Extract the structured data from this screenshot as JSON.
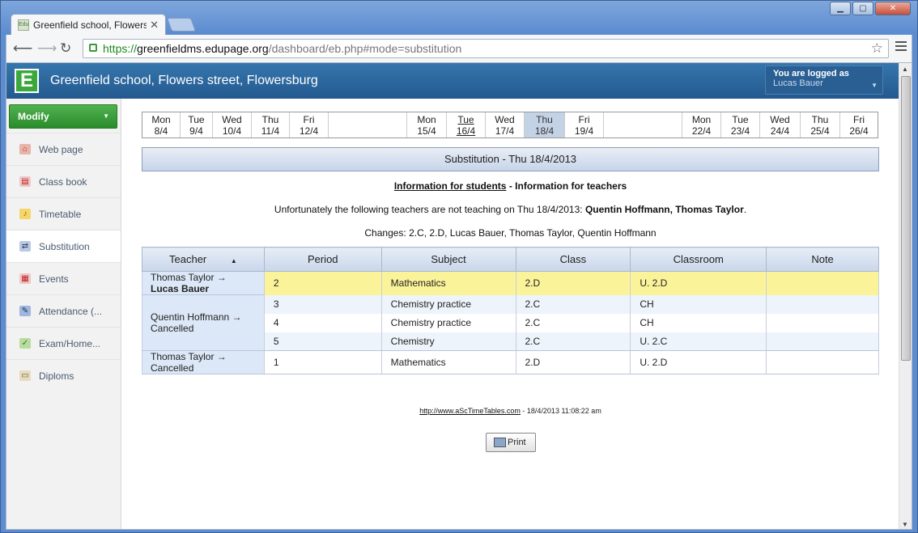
{
  "browser": {
    "tab_title": "Greenfield school, Flowers st",
    "tab_favicon": "Edu",
    "url_scheme": "https://",
    "url_host": "greenfieldms.edupage.org",
    "url_path": "/dashboard/eb.php#mode=substitution"
  },
  "header": {
    "logo": "E",
    "school_name": "Greenfield school, Flowers street, Flowersburg",
    "login_label": "You are logged as",
    "user_name": "Lucas Bauer"
  },
  "sidebar": {
    "modify_label": "Modify",
    "items": [
      {
        "label": "Web page",
        "icon": "house-icon"
      },
      {
        "label": "Class book",
        "icon": "book-icon"
      },
      {
        "label": "Timetable",
        "icon": "bell-icon"
      },
      {
        "label": "Substitution",
        "icon": "substitution-icon"
      },
      {
        "label": "Events",
        "icon": "calendar-icon"
      },
      {
        "label": "Attendance (...",
        "icon": "attendance-icon"
      },
      {
        "label": "Exam/Home...",
        "icon": "exam-icon"
      },
      {
        "label": "Diploms",
        "icon": "diploma-icon"
      }
    ]
  },
  "weeks": [
    [
      {
        "d": "Mon",
        "n": "8/4"
      },
      {
        "d": "Tue",
        "n": "9/4"
      },
      {
        "d": "Wed",
        "n": "10/4"
      },
      {
        "d": "Thu",
        "n": "11/4"
      },
      {
        "d": "Fri",
        "n": "12/4"
      }
    ],
    [
      {
        "d": "Mon",
        "n": "15/4"
      },
      {
        "d": "Tue",
        "n": "16/4"
      },
      {
        "d": "Wed",
        "n": "17/4"
      },
      {
        "d": "Thu",
        "n": "18/4"
      },
      {
        "d": "Fri",
        "n": "19/4"
      }
    ],
    [
      {
        "d": "Mon",
        "n": "22/4"
      },
      {
        "d": "Tue",
        "n": "23/4"
      },
      {
        "d": "Wed",
        "n": "24/4"
      },
      {
        "d": "Thu",
        "n": "25/4"
      },
      {
        "d": "Fri",
        "n": "26/4"
      }
    ]
  ],
  "main": {
    "heading": "Substitution - Thu 18/4/2013",
    "link_students": "Information for students",
    "link_separator": " - ",
    "link_teachers": "Information for teachers",
    "absent_prefix": "Unfortunately the following teachers are not teaching on Thu 18/4/2013: ",
    "absent_names": "Quentin Hoffmann, Thomas Taylor",
    "absent_suffix": ".",
    "changes": "Changes: 2.C, 2.D, Lucas Bauer, Thomas Taylor, Quentin Hoffmann"
  },
  "table": {
    "headers": [
      "Teacher",
      "Period",
      "Subject",
      "Class",
      "Classroom",
      "Note"
    ],
    "groups": [
      {
        "teacher": "Thomas Taylor →",
        "sub": "Lucas Bauer",
        "sub_bold": true,
        "rows": [
          {
            "period": "2",
            "subject": "Mathematics",
            "class": "2.D",
            "room": "U. 2.D",
            "note": ""
          }
        ]
      },
      {
        "teacher": "Quentin Hoffmann →",
        "sub": "Cancelled",
        "sub_bold": false,
        "rows": [
          {
            "period": "3",
            "subject": "Chemistry practice",
            "class": "2.C",
            "room": "CH",
            "note": ""
          },
          {
            "period": "4",
            "subject": "Chemistry practice",
            "class": "2.C",
            "room": "CH",
            "note": ""
          },
          {
            "period": "5",
            "subject": "Chemistry",
            "class": "2.C",
            "room": "U. 2.C",
            "note": ""
          }
        ]
      },
      {
        "teacher": "Thomas Taylor →",
        "sub": "Cancelled",
        "sub_bold": false,
        "rows": [
          {
            "period": "1",
            "subject": "Mathematics",
            "class": "2.D",
            "room": "U. 2.D",
            "note": ""
          }
        ]
      }
    ]
  },
  "footer": {
    "link": "http://www.aScTimeTables.com",
    "text": " - 18/4/2013 11:08:22 am"
  },
  "print_label": "Print"
}
